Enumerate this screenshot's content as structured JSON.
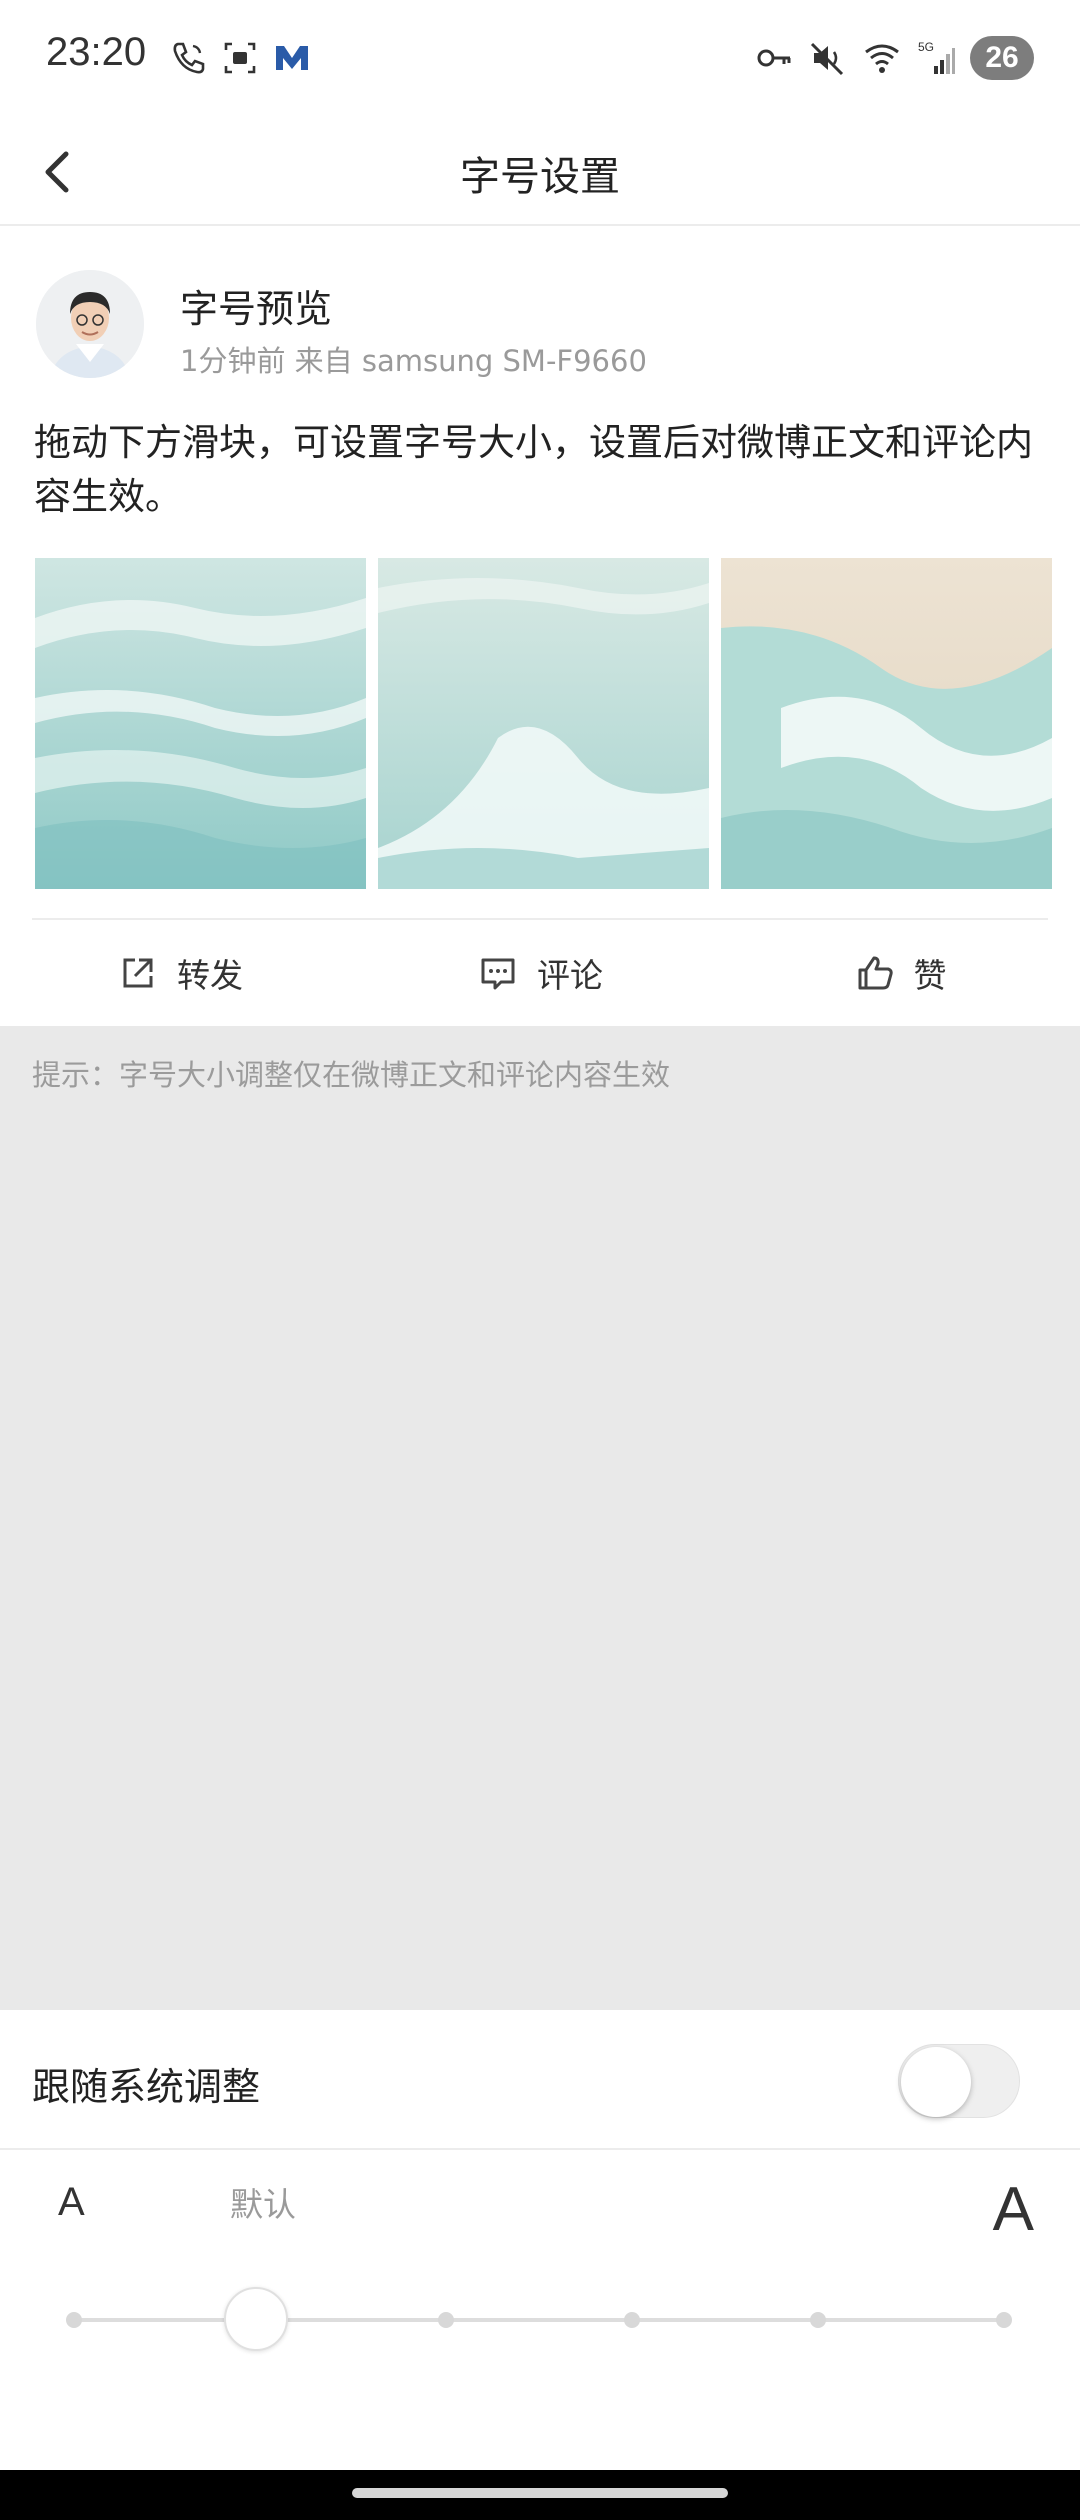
{
  "status_bar": {
    "time": "23:20",
    "battery": "26",
    "left_icons": [
      "phone-icon",
      "screenshot-icon",
      "mail-m-icon"
    ],
    "right_icons": [
      "key-icon",
      "mute-icon",
      "wifi-icon",
      "signal-5g-icon"
    ],
    "network": "5G"
  },
  "header": {
    "title": "字号设置",
    "back_icon": "chevron-left-icon"
  },
  "post": {
    "name": "字号预览",
    "meta": "1分钟前  来自 samsung SM-F9660",
    "body": "拖动下方滑块，可设置字号大小，设置后对微博正文和评论内容生效。",
    "photo_count": 3
  },
  "actions": {
    "repost": "转发",
    "comment": "评论",
    "like": "赞"
  },
  "tip": "提示：字号大小调整仅在微博正文和评论内容生效",
  "settings": {
    "follow_system_label": "跟随系统调整",
    "follow_system_on": false,
    "small_a": "A",
    "big_a": "A",
    "default_label": "默认",
    "slider_steps": 6,
    "slider_value_index": 1
  },
  "colors": {
    "gray_bg": "#e9e9e9",
    "text_primary": "#222222",
    "text_secondary": "#9a9a9a"
  }
}
